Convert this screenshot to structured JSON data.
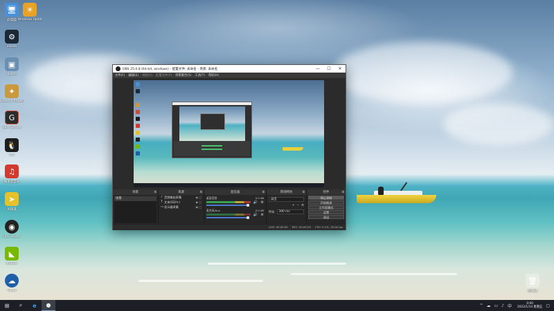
{
  "desktop": {
    "icons": [
      {
        "label": "此电脑",
        "icon": "computer-icon",
        "color": "#4a90d9"
      },
      {
        "label": "Windows Update",
        "icon": "update-icon",
        "color": "#e8a228"
      },
      {
        "label": "Steam",
        "icon": "steam-icon",
        "color": "#1b2838"
      },
      {
        "label": "Bilibili",
        "icon": "bilibili-icon",
        "color": "#6a8fb0"
      },
      {
        "label": "Genshin Impact",
        "icon": "genshin-icon",
        "color": "#c99a3b"
      },
      {
        "label": "Epic Games",
        "icon": "epic-icon",
        "color": "#2b2b2b"
      },
      {
        "label": "QQ",
        "icon": "qq-icon",
        "color": "#1d1d1d"
      },
      {
        "label": "网易云音乐",
        "icon": "netease-music-icon",
        "color": "#d23a2f"
      },
      {
        "label": "加速器",
        "icon": "accelerator-icon",
        "color": "#e6c22a"
      },
      {
        "label": "OBS Studio",
        "icon": "obs-icon",
        "color": "#222222"
      },
      {
        "label": "NVIDIA",
        "icon": "nvidia-icon",
        "color": "#76b900"
      },
      {
        "label": "Cloud",
        "icon": "cloud-app-icon",
        "color": "#1e5fa8"
      }
    ],
    "recycle_bin": {
      "label": "回收站",
      "icon": "recycle-bin-icon"
    }
  },
  "obs_window": {
    "title": "OBS 25.0.8 (64-bit, windows) - 配置文件: 未命名 - 场景: 未命名",
    "controls": {
      "minimize": "—",
      "maximize": "☐",
      "close": "✕"
    },
    "menu": [
      "文件(F)",
      "编辑(E)",
      "视图(V)",
      "配置文件(P)",
      "场景集合(S)",
      "工具(T)",
      "帮助(H)"
    ],
    "docks": {
      "scenes": {
        "title": "场景",
        "items": [
          "场景"
        ]
      },
      "sources": {
        "title": "来源",
        "items": [
          {
            "icon": "audio-capture-icon",
            "glyph": "♪",
            "label": "音频输出采集"
          },
          {
            "icon": "text-icon",
            "glyph": "T",
            "label": "文本(GDI+)"
          },
          {
            "icon": "display-capture-icon",
            "glyph": "▭",
            "label": "显示器采集"
          }
        ]
      },
      "mixer": {
        "title": "混音器",
        "channels": [
          {
            "name": "桌面音频",
            "db": "0.0 dB"
          },
          {
            "name": "麦克风/Aux",
            "db": "0.0 dB"
          }
        ]
      },
      "transitions": {
        "title": "转场特效",
        "type": "淡出",
        "duration_label": "时长",
        "duration": "300 ms"
      },
      "controls": {
        "title": "控件",
        "buttons": [
          "停止录制",
          "开始推流",
          "工作室模式",
          "设置",
          "退出"
        ]
      }
    },
    "status": {
      "live": "LIVE: 00:00:00",
      "rec": "REC: 00:00:05",
      "cpu": "CPU: 0.1%, 30.00 fps"
    }
  },
  "taskbar": {
    "start": "⊞",
    "items": [
      {
        "icon": "search-icon",
        "glyph": "⌕"
      },
      {
        "icon": "edge-icon",
        "glyph": "e"
      },
      {
        "icon": "obs-icon",
        "glyph": "●"
      }
    ],
    "tray": [
      "^",
      "☁",
      "▭",
      "♪",
      "中"
    ],
    "clock": {
      "time": "0:00",
      "date": "2022/1/14 星期五"
    }
  }
}
